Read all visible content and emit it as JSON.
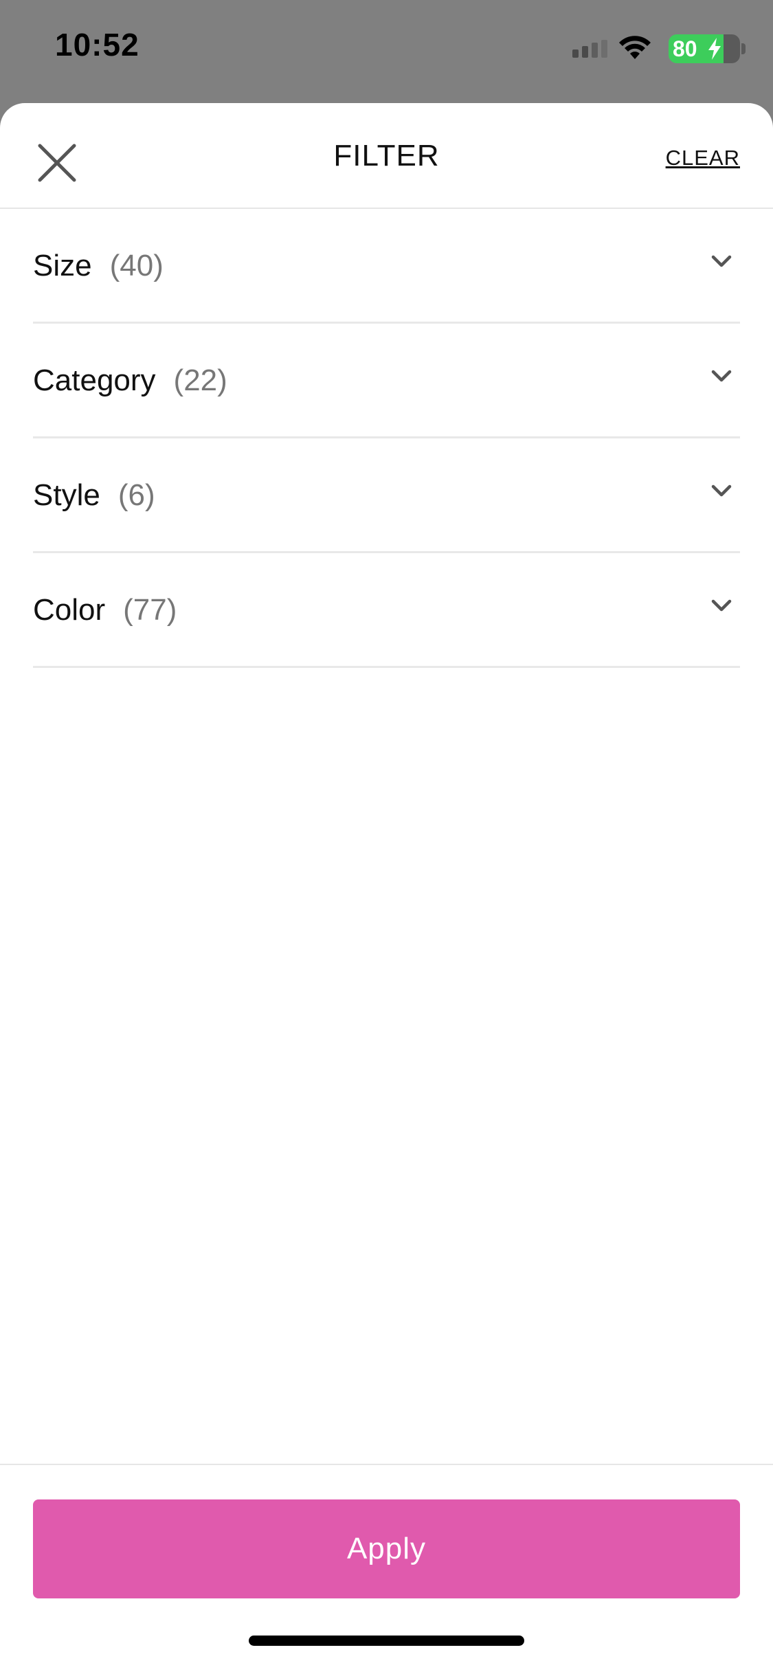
{
  "status_bar": {
    "time": "10:52",
    "battery_level": "80",
    "icons": [
      "signal-icon",
      "wifi-icon",
      "battery-charging-icon"
    ]
  },
  "header": {
    "title": "FILTER",
    "clear_label": "CLEAR",
    "close_icon": "close-icon"
  },
  "filters": [
    {
      "label": "Size",
      "count": "(40)"
    },
    {
      "label": "Category",
      "count": "(22)"
    },
    {
      "label": "Style",
      "count": "(6)"
    },
    {
      "label": "Color",
      "count": "(77)"
    }
  ],
  "footer": {
    "apply_label": "Apply",
    "apply_color": "#e05aad"
  }
}
